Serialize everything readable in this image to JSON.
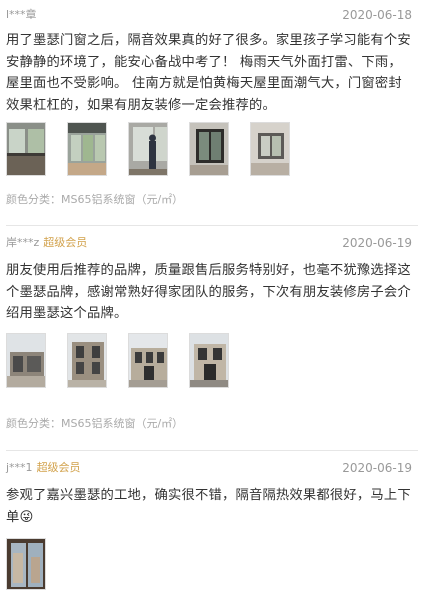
{
  "reviews": [
    {
      "user": "l***章",
      "vip": "",
      "date": "2020-06-18",
      "text": "用了墨瑟门窗之后，隔音效果真的好了很多。家里孩子学习能有个安安静静的环境了，能安心备战中考了！ 梅雨天气外面打雷、下雨，屋里面也不受影响。 住南方就是怕黄梅天屋里面潮气大，门窗密封效果杠杠的，如果有朋友装修一定会推荐的。",
      "photos": [
        "window-interior-photo",
        "sunroom-photo",
        "workman-photo",
        "dark-window-photo",
        "room-window-photo"
      ],
      "category": "颜色分类：MS65铝系统窗（元/㎡）"
    },
    {
      "user": "岸***z",
      "vip": "超级会员",
      "date": "2020-06-19",
      "text": "朋友使用后推荐的品牌，质量跟售后服务特别好，也毫不犹豫选择这个墨瑟品牌，感谢常熟好得家团队的服务，下次有朋友装修房子会介绍用墨瑟这个品牌。",
      "photos": [
        "house-front-photo",
        "house-side-photo",
        "villa-photo",
        "villa-entrance-photo"
      ],
      "category": "颜色分类：MS65铝系统窗（元/㎡）"
    },
    {
      "user": "j***1",
      "vip": "超级会员",
      "date": "2020-06-19",
      "text": "参观了嘉兴墨瑟的工地，确实很不错，隔音隔热效果都很好，马上下单😜",
      "photos": [
        "building-window-photo"
      ],
      "category": ""
    }
  ]
}
